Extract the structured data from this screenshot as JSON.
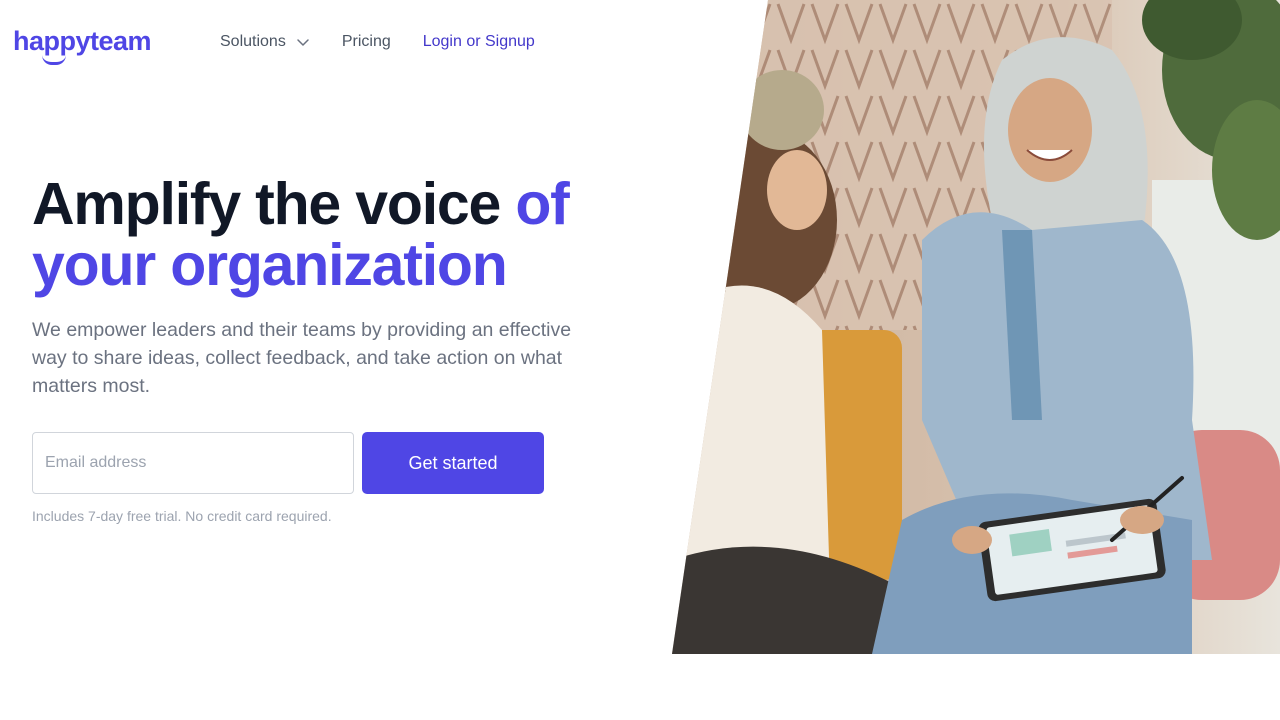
{
  "brand": {
    "logo_text": "happyteam",
    "accent_color": "#4f46e5"
  },
  "nav": {
    "items": [
      {
        "label": "Solutions",
        "icon": "chevron-down-icon"
      },
      {
        "label": "Pricing"
      },
      {
        "label": "Login or Signup"
      }
    ]
  },
  "hero": {
    "headline_dark": "Amplify the voice ",
    "headline_accent": "of your organization",
    "subtext": "We empower leaders and their teams by providing an effective way to share ideas, collect feedback, and take action on what matters most.",
    "email_placeholder": "Email address",
    "email_value": "",
    "cta_label": "Get started",
    "note": "Includes 7-day free trial. No credit card required."
  },
  "photo": {
    "subject": "Two women smiling and talking, one holding a tablet with a stylus"
  }
}
